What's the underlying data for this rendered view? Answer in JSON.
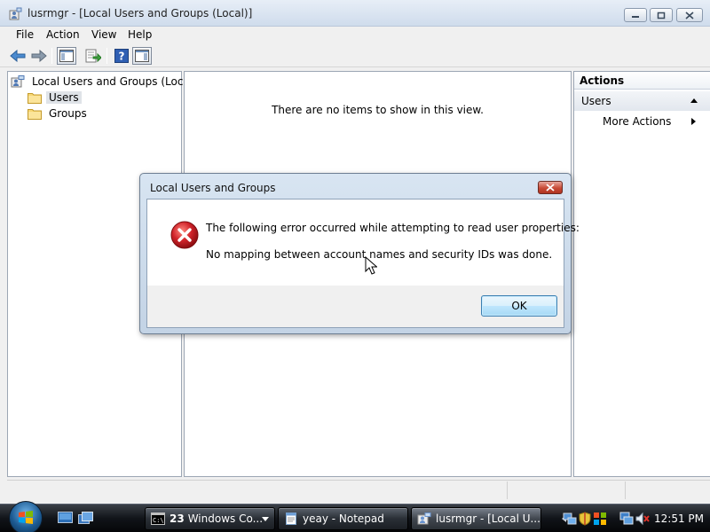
{
  "window": {
    "title": "lusrmgr - [Local Users and Groups (Local)]"
  },
  "menu": {
    "file": "File",
    "action": "Action",
    "view": "View",
    "help": "Help"
  },
  "toolbar": {
    "buttons": [
      "back-icon",
      "forward-icon",
      "show-hide-console-tree-icon",
      "export-list-icon",
      "help-icon",
      "show-hide-action-pane-icon"
    ]
  },
  "tree": {
    "root": "Local Users and Groups (Local)",
    "items": [
      {
        "label": "Users",
        "selected": true
      },
      {
        "label": "Groups",
        "selected": false
      }
    ]
  },
  "center": {
    "empty_message": "There are no items to show in this view."
  },
  "actions_pane": {
    "header": "Actions",
    "section": "Users",
    "more_actions": "More Actions"
  },
  "dialog": {
    "title": "Local Users and Groups",
    "line1": "The following error occurred while attempting to read user properties:",
    "line2": "No mapping between account names and security IDs was done.",
    "ok_label": "OK",
    "icon": "error-icon"
  },
  "taskbar": {
    "tasks": [
      {
        "count": "23",
        "label": "Windows Co...",
        "icon": "cmd-icon"
      },
      {
        "label": "yeay - Notepad",
        "icon": "notepad-icon"
      },
      {
        "label": "lusrmgr - [Local U...",
        "icon": "lusrmgr-icon",
        "active": true
      }
    ],
    "clock": "12:51 PM"
  },
  "colors": {
    "titlebar": "#cfdcec",
    "error_red": "#d0232a",
    "ok_border": "#3c7fb1",
    "taskbar": "#111419"
  }
}
